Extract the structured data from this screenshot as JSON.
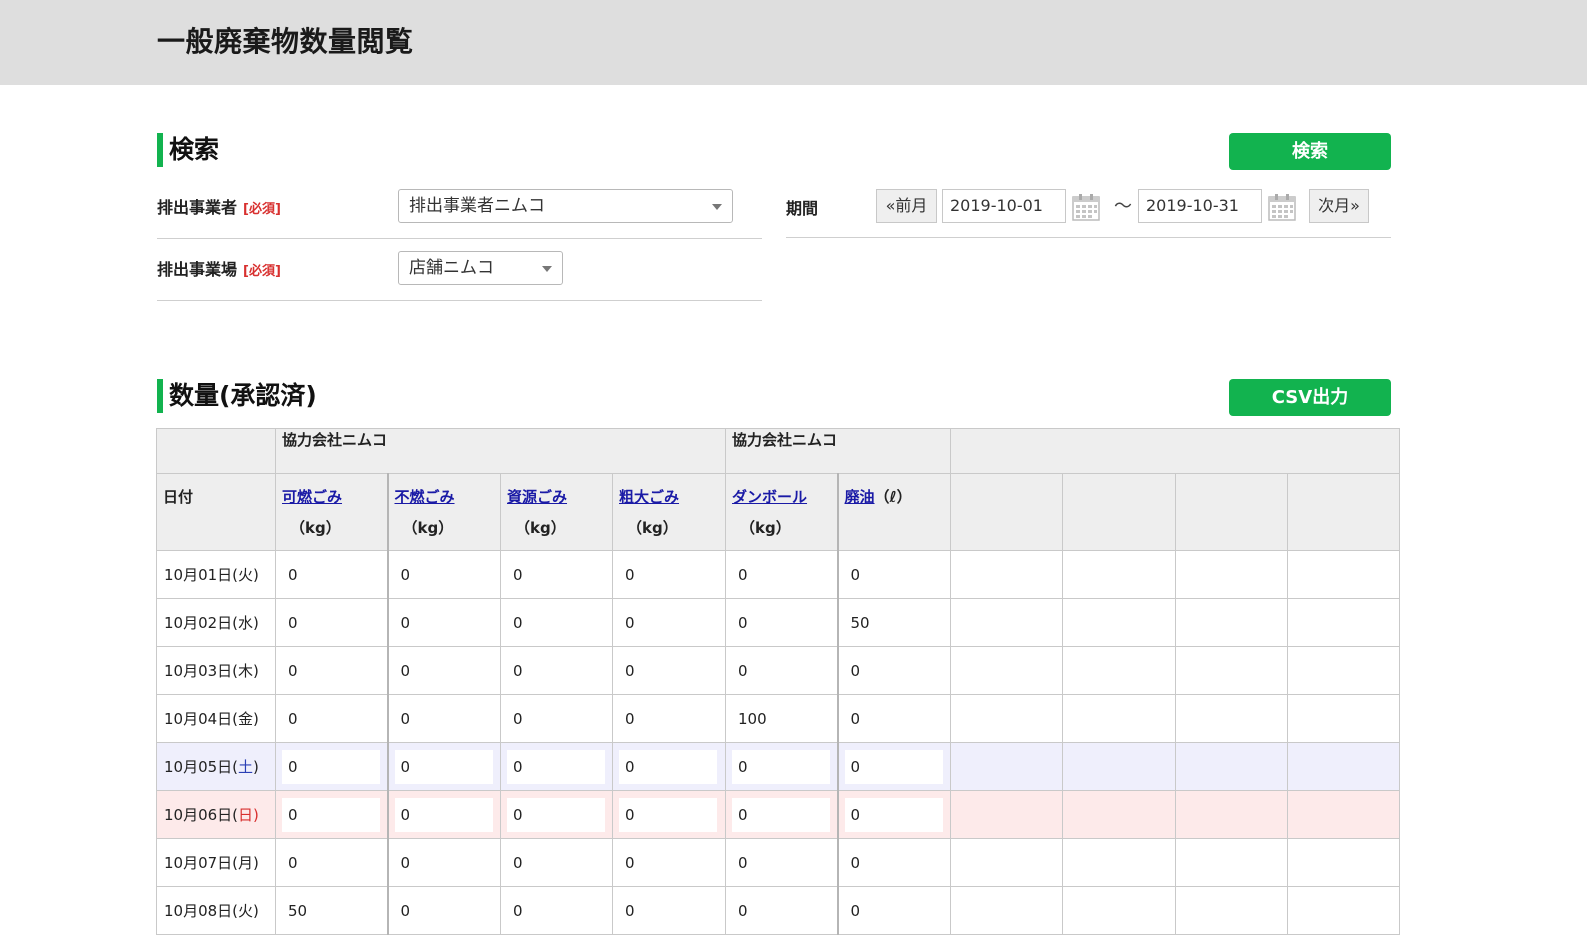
{
  "header": {
    "title": "一般廃棄物数量閲覧"
  },
  "search": {
    "section_title": "検索",
    "search_button": "検索",
    "discharger_label": "排出事業者",
    "discharger_required": "[必須]",
    "discharger_value": "排出事業者ニムコ",
    "site_label": "排出事業場",
    "site_required": "[必須]",
    "site_value": "店舗ニムコ",
    "period_label": "期間",
    "prev_month": "«前月",
    "date_from": "2019-10-01",
    "tilde": "～",
    "date_to": "2019-10-31",
    "next_month": "次月»"
  },
  "quantity": {
    "section_title": "数量(承認済)",
    "csv_button": "CSV出力",
    "group_headers": [
      "協力会社ニムコ",
      "協力会社ニムコ",
      ""
    ],
    "date_header": "日付",
    "columns": [
      {
        "name": "可燃ごみ",
        "unit": "（kg）"
      },
      {
        "name": "不燃ごみ",
        "unit": "（kg）"
      },
      {
        "name": "資源ごみ",
        "unit": "（kg）"
      },
      {
        "name": "粗大ごみ",
        "unit": "（kg）"
      },
      {
        "name": "ダンボール",
        "unit": "（kg）"
      },
      {
        "name": "廃油",
        "unit": "（ℓ）"
      }
    ],
    "rows": [
      {
        "date": "10月01日(",
        "dow": "火",
        "close": ")",
        "values": [
          "0",
          "0",
          "0",
          "0",
          "0",
          "0"
        ]
      },
      {
        "date": "10月02日(",
        "dow": "水",
        "close": ")",
        "values": [
          "0",
          "0",
          "0",
          "0",
          "0",
          "50"
        ]
      },
      {
        "date": "10月03日(",
        "dow": "木",
        "close": ")",
        "values": [
          "0",
          "0",
          "0",
          "0",
          "0",
          "0"
        ]
      },
      {
        "date": "10月04日(",
        "dow": "金",
        "close": ")",
        "values": [
          "0",
          "0",
          "0",
          "0",
          "100",
          "0"
        ]
      },
      {
        "date": "10月05日(",
        "dow": "土",
        "close": ")",
        "values": [
          "0",
          "0",
          "0",
          "0",
          "0",
          "0"
        ]
      },
      {
        "date": "10月06日(",
        "dow": "日",
        "close": ")",
        "values": [
          "0",
          "0",
          "0",
          "0",
          "0",
          "0"
        ]
      },
      {
        "date": "10月07日(",
        "dow": "月",
        "close": ")",
        "values": [
          "0",
          "0",
          "0",
          "0",
          "0",
          "0"
        ]
      },
      {
        "date": "10月08日(",
        "dow": "火",
        "close": ")",
        "values": [
          "50",
          "0",
          "0",
          "0",
          "0",
          "0"
        ]
      }
    ]
  },
  "colors": {
    "accent": "#12b34f",
    "saturday_row": "#efeffc",
    "sunday_row": "#fdeaea",
    "required": "#d8302f"
  }
}
